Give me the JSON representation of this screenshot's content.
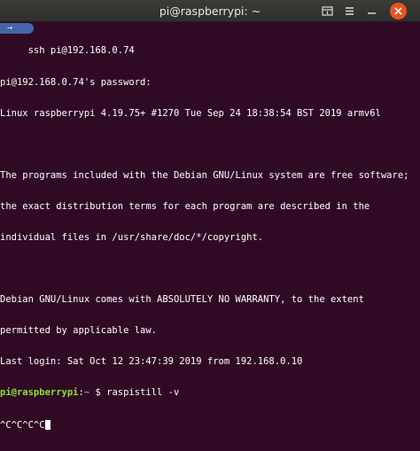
{
  "window": {
    "title": "pi@raspberrypi: ~",
    "left_marker": "→"
  },
  "terminal": {
    "ssh_line": "     ssh pi@192.168.0.74",
    "lines": [
      "pi@192.168.0.74's password:",
      "Linux raspberrypi 4.19.75+ #1270 Tue Sep 24 18:38:54 BST 2019 armv6l",
      "",
      "The programs included with the Debian GNU/Linux system are free software;",
      "the exact distribution terms for each program are described in the",
      "individual files in /usr/share/doc/*/copyright.",
      "",
      "Debian GNU/Linux comes with ABSOLUTELY NO WARRANTY, to the extent",
      "permitted by applicable law.",
      "Last login: Sat Oct 12 23:47:39 2019 from 192.168.0.10"
    ],
    "prompt_user": "pi@raspberrypi",
    "prompt_sep": ":",
    "prompt_path": "~",
    "prompt_dollar": " $ ",
    "command": "raspistill -v",
    "interrupt": "^C^C^C^C"
  },
  "colors": {
    "background": "#300a24",
    "prompt_user": "#8ae234",
    "prompt_path": "#729fcf",
    "close_button": "#e95420"
  },
  "icons": {
    "new_tab": "new-tab-icon",
    "menu": "hamburger-menu-icon",
    "minimize": "minimize-icon",
    "close": "close-icon"
  }
}
